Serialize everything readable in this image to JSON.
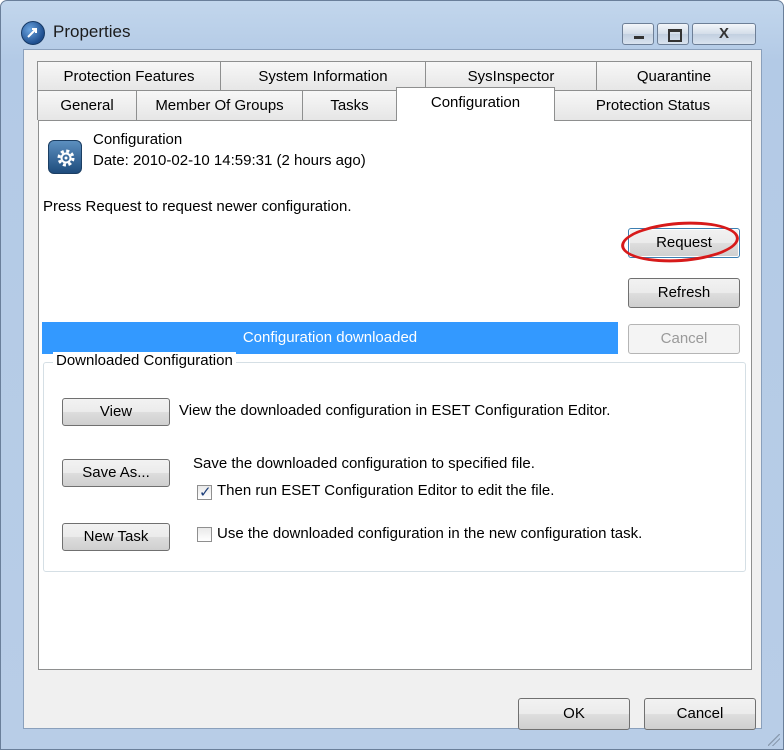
{
  "window": {
    "title": "Properties",
    "close_label": "X"
  },
  "tabs_row1": [
    "Protection Features",
    "System Information",
    "SysInspector",
    "Quarantine"
  ],
  "tabs_row2": [
    "General",
    "Member Of Groups",
    "Tasks",
    "Configuration",
    "Protection Status"
  ],
  "active_tab": "Configuration",
  "header": {
    "title": "Configuration",
    "date": "Date: 2010-02-10 14:59:31 (2 hours ago)"
  },
  "hint": "Press Request to request newer configuration.",
  "buttons": {
    "request": "Request",
    "refresh": "Refresh",
    "cancel": "Cancel",
    "view": "View",
    "save_as": "Save As...",
    "new_task": "New Task",
    "ok": "OK",
    "dialog_cancel": "Cancel"
  },
  "progress": {
    "text": "Configuration downloaded",
    "value": 1.0,
    "color": "#3399ff"
  },
  "downloaded": {
    "legend": "Downloaded Configuration",
    "view_desc": "View the downloaded configuration in ESET Configuration Editor.",
    "save_desc": "Save the downloaded configuration to specified file.",
    "run_editor": {
      "label": "Then run ESET Configuration Editor to edit the file.",
      "checked": true
    },
    "use_in_task": {
      "label": "Use the downloaded configuration in the new configuration task.",
      "checked": false
    }
  },
  "icons": {
    "app": "eset-admin-icon",
    "config": "gear-icon"
  },
  "colors": {
    "highlight_circle": "#d71a1a",
    "selection": "#3399ff"
  }
}
